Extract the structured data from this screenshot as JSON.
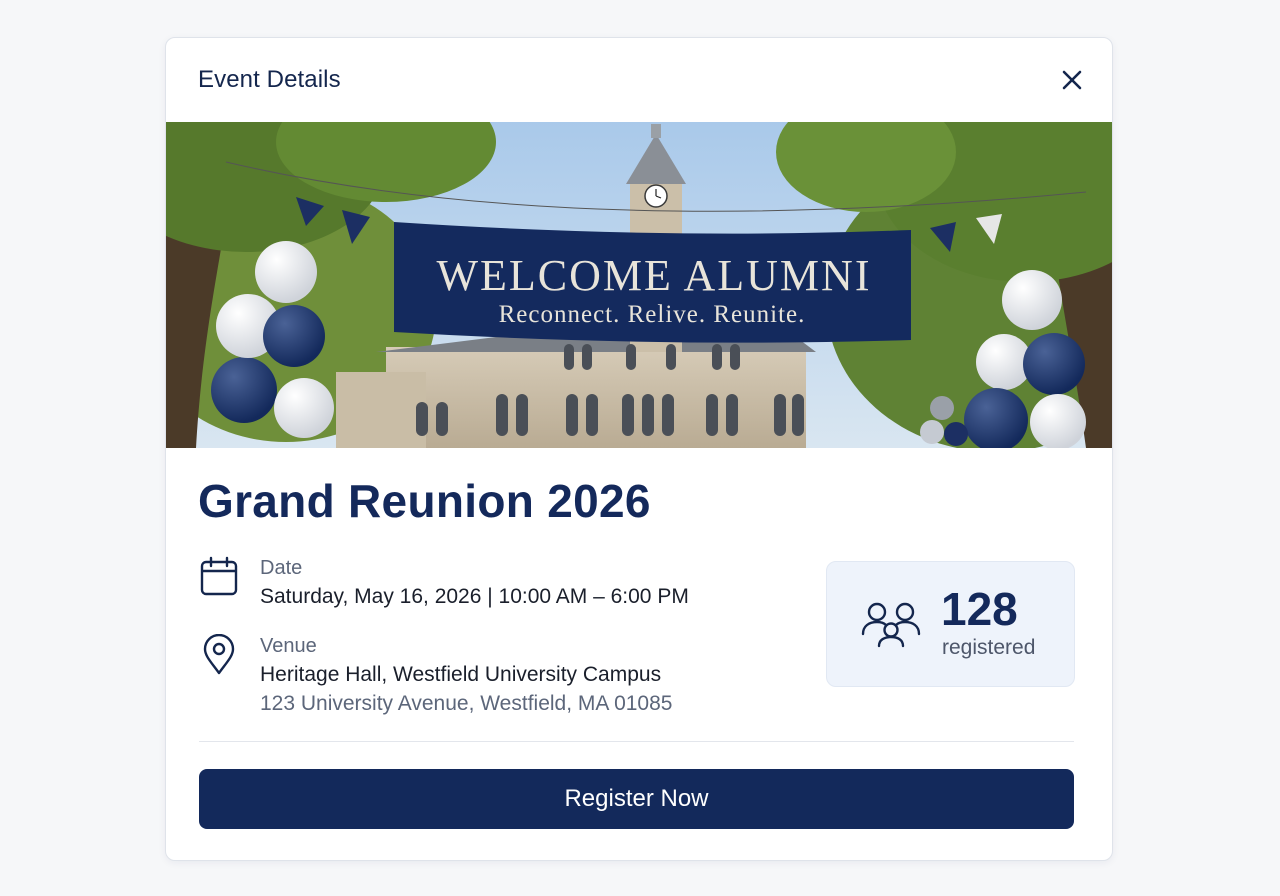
{
  "modal": {
    "title": "Event Details",
    "close_icon": "close-icon"
  },
  "hero": {
    "banner_title": "WELCOME ALUMNI",
    "banner_subtitle": "Reconnect. Relive. Reunite."
  },
  "event": {
    "title": "Grand Reunion 2026",
    "date": {
      "icon": "calendar-icon",
      "label": "Date",
      "value": "Saturday, May 16, 2026 | 10:00 AM – 6:00 PM"
    },
    "venue": {
      "icon": "location-pin-icon",
      "label": "Venue",
      "name": "Heritage Hall, Westfield University Campus",
      "address": "123 University Avenue, Westfield, MA 01085"
    }
  },
  "registrations": {
    "icon": "group-icon",
    "count": "128",
    "label": "registered"
  },
  "actions": {
    "register_label": "Register Now"
  },
  "colors": {
    "primary": "#13295b",
    "accent_card": "#eef3fb",
    "muted_text": "#5c667a"
  }
}
